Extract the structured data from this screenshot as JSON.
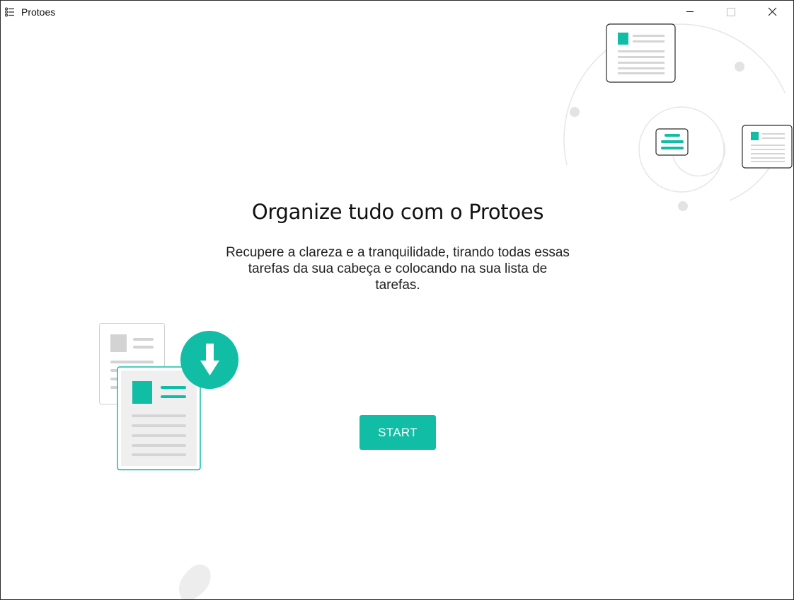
{
  "window": {
    "title": "Protoes",
    "controls": {
      "minimize": "minimize-icon",
      "maximize": "maximize-icon",
      "close": "close-icon"
    }
  },
  "main": {
    "heading": "Organize tudo com o Protoes",
    "subtitle": "Recupere a clareza e a tranquilidade, tirando todas essas tarefas da sua cabeça e colocando na sua lista de tarefas.",
    "start_label": "START"
  },
  "colors": {
    "accent": "#12bda5",
    "accent_dark": "#0fa08c",
    "line": "#e3e3e3",
    "doc_border": "#2b2b2b"
  },
  "icons": {
    "app": "checklist-icon",
    "download": "download-arrow-icon"
  }
}
